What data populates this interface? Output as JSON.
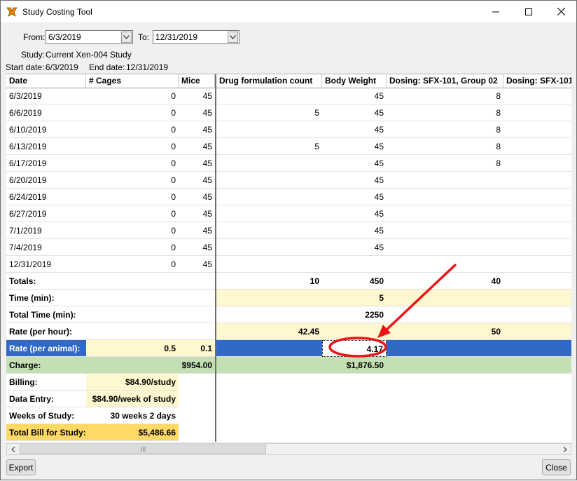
{
  "window": {
    "title": "Study Costing Tool"
  },
  "filters": {
    "from_label": "From:",
    "from_value": "6/3/2019",
    "to_label": "To:",
    "to_value": "12/31/2019"
  },
  "study": {
    "label": "Study:",
    "name": "Current Xen-004  Study",
    "start_label": "Start date:",
    "start_value": "6/3/2019",
    "end_label": "End date:",
    "end_value": "12/31/2019"
  },
  "grid": {
    "columns": [
      "Date",
      "# Cages",
      "Mice",
      "Drug formulation count",
      "Body Weight",
      "Dosing: SFX-101, Group 02",
      "Dosing: SFX-101,"
    ],
    "rows": [
      {
        "date": "6/3/2019",
        "cages": "0",
        "mice": "45",
        "drug": "",
        "bw": "45",
        "dose": "8"
      },
      {
        "date": "6/6/2019",
        "cages": "0",
        "mice": "45",
        "drug": "5",
        "bw": "45",
        "dose": "8"
      },
      {
        "date": "6/10/2019",
        "cages": "0",
        "mice": "45",
        "drug": "",
        "bw": "45",
        "dose": "8"
      },
      {
        "date": "6/13/2019",
        "cages": "0",
        "mice": "45",
        "drug": "5",
        "bw": "45",
        "dose": "8"
      },
      {
        "date": "6/17/2019",
        "cages": "0",
        "mice": "45",
        "drug": "",
        "bw": "45",
        "dose": "8"
      },
      {
        "date": "6/20/2019",
        "cages": "0",
        "mice": "45",
        "drug": "",
        "bw": "45",
        "dose": ""
      },
      {
        "date": "6/24/2019",
        "cages": "0",
        "mice": "45",
        "drug": "",
        "bw": "45",
        "dose": ""
      },
      {
        "date": "6/27/2019",
        "cages": "0",
        "mice": "45",
        "drug": "",
        "bw": "45",
        "dose": ""
      },
      {
        "date": "7/1/2019",
        "cages": "0",
        "mice": "45",
        "drug": "",
        "bw": "45",
        "dose": ""
      },
      {
        "date": "7/4/2019",
        "cages": "0",
        "mice": "45",
        "drug": "",
        "bw": "45",
        "dose": ""
      },
      {
        "date": "12/31/2019",
        "cages": "0",
        "mice": "45",
        "drug": "",
        "bw": "",
        "dose": ""
      }
    ],
    "totals": {
      "label": "Totals:",
      "drug": "10",
      "bw": "450",
      "dose": "40"
    },
    "time": {
      "label": "Time (min):",
      "bw": "5"
    },
    "total_time": {
      "label": "Total Time (min):",
      "bw": "2250"
    },
    "rate_hour": {
      "label": "Rate (per hour):",
      "drug": "42.45",
      "dose": "50"
    },
    "rate_animal": {
      "label": "Rate (per animal):",
      "cages": "0.5",
      "mice": "0.1",
      "bw": "4.17"
    },
    "charge": {
      "label": "Charge:",
      "mice": "$954.00",
      "bw": "$1,876.50"
    },
    "billing": {
      "label": "Billing:",
      "value": "$84.90/study"
    },
    "data_entry": {
      "label": "Data Entry:",
      "value": "$84.90/week of study"
    },
    "weeks": {
      "label": "Weeks of Study:",
      "value": "30 weeks 2 days"
    },
    "total_bill": {
      "label": "Total Bill for Study:",
      "value": "$5,486.66"
    }
  },
  "buttons": {
    "export": "Export",
    "close": "Close"
  },
  "colors": {
    "yellow": "#fff7cf",
    "green": "#c5dfb4",
    "blue": "#3169c6",
    "orange": "#ffd966",
    "annotation": "#e8161b"
  },
  "icons": [
    "app-icon",
    "minimize-icon",
    "maximize-icon",
    "close-icon",
    "chevron-down-icon",
    "scroll-left-icon",
    "scroll-right-icon"
  ]
}
